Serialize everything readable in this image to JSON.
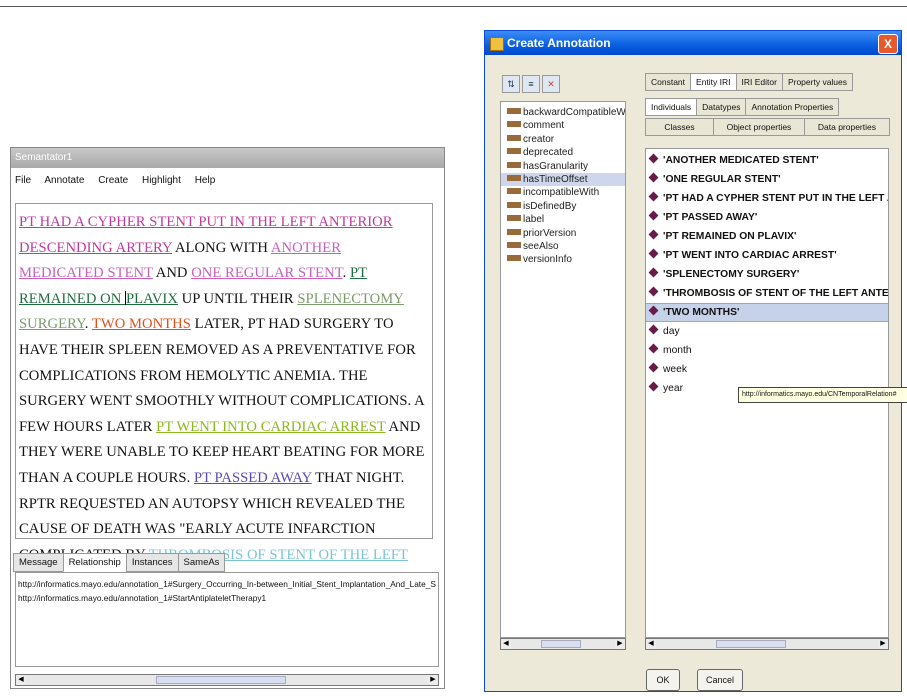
{
  "semantator": {
    "title": "Semantator1",
    "menu": [
      "File",
      "Annotate",
      "Create",
      "Highlight",
      "Help"
    ],
    "document": {
      "p1": "PT HAD A CYPHER STENT PUT IN THE LEFT ANTERIOR DESCENDING ARTERY",
      "p2": " ALONG WITH ",
      "p3": "ANOTHER MEDICATED STENT",
      "p4": " AND ",
      "p5": "ONE REGULAR STENT",
      "p6": ". ",
      "p7a": "PT REMAINED ON ",
      "p7b": "PLAVIX",
      "p8": " UP UNTIL THEIR ",
      "p9": "SPLENECTOMY SURGERY",
      "p10": ". ",
      "p11": "TWO MONTHS",
      "p12": " LATER, PT HAD SURGERY TO HAVE THEIR SPLEEN REMOVED AS A PREVENTATIVE FOR COMPLICATIONS FROM HEMOLYTIC ANEMIA. THE SURGERY WENT SMOOTHLY WITHOUT COMPLICATIONS. A FEW HOURS LATER ",
      "p13": "PT WENT INTO CARDIAC ARREST",
      "p14": " AND THEY WERE UNABLE TO KEEP HEART BEATING FOR MORE THAN A COUPLE HOURS. ",
      "p15": "PT PASSED AWAY",
      "p16": " THAT NIGHT. RPTR REQUESTED AN AUTOPSY WHICH REVEALED THE CAUSE OF DEATH WAS \"EARLY ACUTE INFARCTION COMPLICATED BY ",
      "p17": "THROMBOSIS OF STENT OF THE LEFT ANTERIOR DESCENDING ARTERY",
      "p18": ".\""
    },
    "tabs": [
      "Message",
      "Relationship",
      "Instances",
      "SameAs"
    ],
    "relations": [
      "http://informatics.mayo.edu/annotation_1#Surgery_Occurring_In-between_Initial_Stent_Implantation_And_Late_S",
      "http://informatics.mayo.edu/annotation_1#StartAntiplateletTherapy1"
    ]
  },
  "dialog": {
    "title": "Create Annotation",
    "close": "X",
    "properties": [
      "backwardCompatibleWith",
      "comment",
      "creator",
      "deprecated",
      "hasGranularity",
      "hasTimeOffset",
      "incompatibleWith",
      "isDefinedBy",
      "label",
      "priorVersion",
      "seeAlso",
      "versionInfo"
    ],
    "tabs_row1": [
      "Constant",
      "Entity IRI",
      "IRI Editor",
      "Property values"
    ],
    "tabs_row2": [
      "Individuals",
      "Datatypes",
      "Annotation Properties"
    ],
    "tabs_row3": [
      "Classes",
      "Object properties",
      "Data properties"
    ],
    "entities_bold": [
      "'ANOTHER MEDICATED STENT'",
      "'ONE REGULAR STENT'",
      "'PT HAD A CYPHER STENT PUT IN THE LEFT ANTEI",
      "'PT PASSED AWAY'",
      "'PT REMAINED ON PLAVIX'",
      "'PT WENT INTO CARDIAC ARREST'",
      "'SPLENECTOMY SURGERY'",
      "'THROMBOSIS OF STENT OF THE LEFT ANTERIOR",
      "'TWO MONTHS'"
    ],
    "entities_plain": [
      "day",
      "month",
      "week",
      "year"
    ],
    "tooltip": "http://informatics.mayo.edu/CNTemporalRelation#",
    "ok": "OK",
    "cancel": "Cancel"
  }
}
